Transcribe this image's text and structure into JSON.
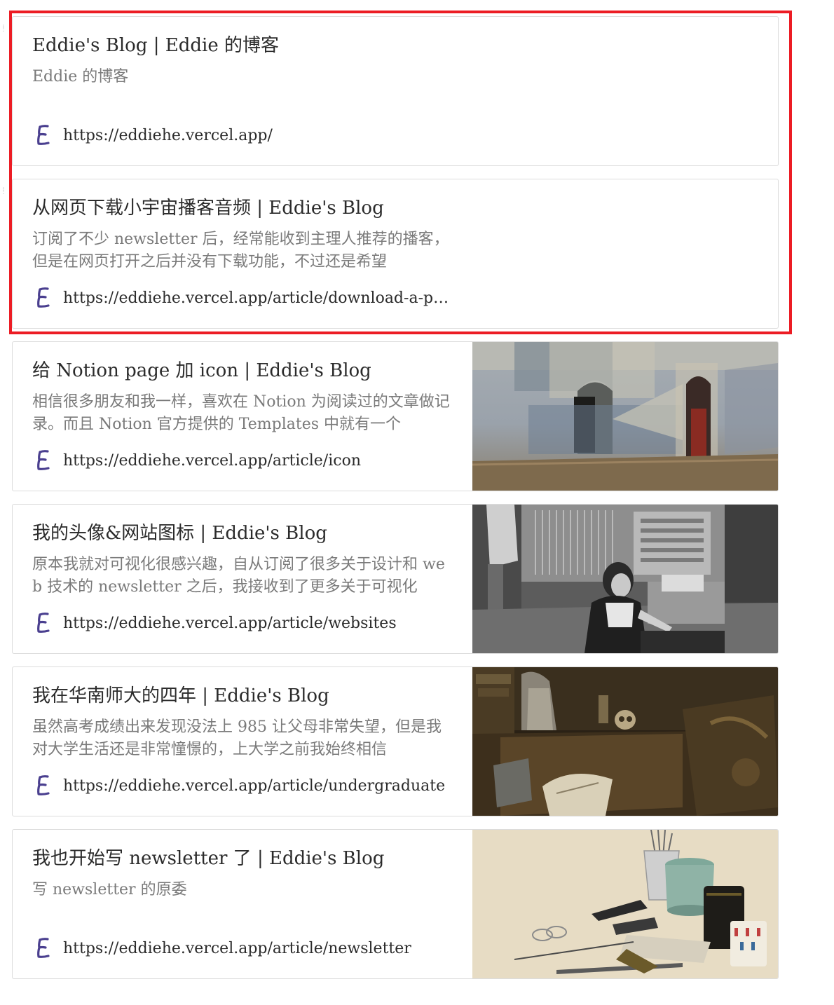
{
  "bookmarks": [
    {
      "title": "Eddie's Blog | Eddie 的博客",
      "description": "Eddie 的博客",
      "url": "https://eddiehe.vercel.app/",
      "favicon": "eddie-e-icon",
      "image": null
    },
    {
      "title": "从网页下载小宇宙播客音频 | Eddie's Blog",
      "description": "订阅了不少 newsletter 后，经常能收到主理人推荐的播客，但是在网页打开之后并没有下载功能，不过还是希望",
      "url": "https://eddiehe.vercel.app/article/download-a-podc…",
      "favicon": "eddie-e-icon",
      "image": null
    },
    {
      "title": "给 Notion page 加 icon | Eddie's Blog",
      "description": "相信很多朋友和我一样，喜欢在 Notion 为阅读过的文章做记录。而且 Notion 官方提供的 Templates 中就有一个",
      "url": "https://eddiehe.vercel.app/article/icon",
      "favicon": "eddie-e-icon",
      "image": "painting-moorish-wall"
    },
    {
      "title": "我的头像&网站图标 | Eddie's Blog",
      "description": "原本我就对可视化很感兴趣，自从订阅了很多关于设计和 web 技术的 newsletter 之后，我接收到了更多关于可视化",
      "url": "https://eddiehe.vercel.app/article/websites",
      "favicon": "eddie-e-icon",
      "image": "photo-computer-operator"
    },
    {
      "title": "我在华南师大的四年 | Eddie's Blog",
      "description": "虽然高考成绩出来发现没法上 985 让父母非常失望，但是我对大学生活还是非常憧憬的，上大学之前我始终相信",
      "url": "https://eddiehe.vercel.app/article/undergraduate",
      "favicon": "eddie-e-icon",
      "image": "painting-vanitas-still-life"
    },
    {
      "title": "我也开始写 newsletter 了 | Eddie's Blog",
      "description": "写 newsletter 的原委",
      "url": "https://eddiehe.vercel.app/article/newsletter",
      "favicon": "eddie-e-icon",
      "image": "painting-japanese-still-life"
    }
  ],
  "colors": {
    "selection_border": "#ec1c24",
    "card_border": "#dcdcdc",
    "favicon": "#4a3f8f",
    "title_text": "#2b2b2b",
    "description_text": "#7a7a7a"
  }
}
